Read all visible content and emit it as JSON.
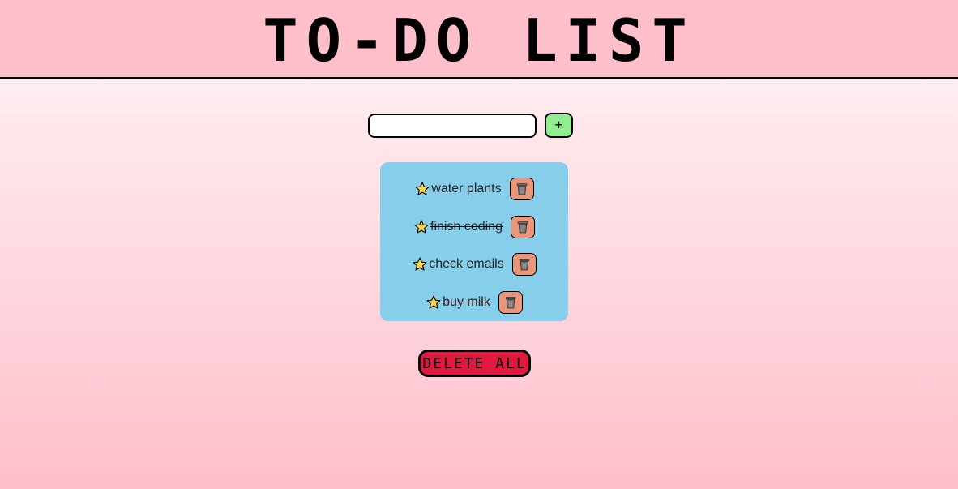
{
  "header": {
    "title": "TO-DO LIST"
  },
  "add_form": {
    "input_value": "",
    "add_label": "+"
  },
  "tasks": [
    {
      "text": "water plants",
      "completed": false,
      "icon": "star-icon",
      "delete_icon": "trash-icon"
    },
    {
      "text": "finish coding",
      "completed": true,
      "icon": "star-icon",
      "delete_icon": "trash-icon"
    },
    {
      "text": "check emails",
      "completed": false,
      "icon": "star-icon",
      "delete_icon": "trash-icon"
    },
    {
      "text": "buy milk",
      "completed": true,
      "icon": "star-icon",
      "delete_icon": "trash-icon"
    }
  ],
  "actions": {
    "delete_all_label": "DELETE ALL"
  },
  "colors": {
    "header_bg": "#ffbfcb",
    "list_bg": "#87ceeb",
    "add_button": "#90ee90",
    "trash_button": "#e9967a",
    "delete_all": "#e0193f",
    "star": "#ffd54a"
  }
}
